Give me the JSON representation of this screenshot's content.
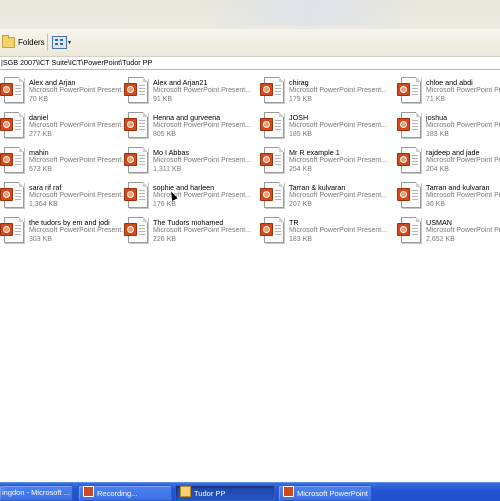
{
  "toolbar": {
    "folders_label": "Folders",
    "views_icon": "views-icon"
  },
  "address": {
    "path": "|SGB 2007\\ICT Suite\\ICT\\PowerPoint\\Tudor PP"
  },
  "files": [
    {
      "name": "Alex and Arjan",
      "type": "Microsoft PowerPoint Present...",
      "size": "70 KB"
    },
    {
      "name": "Alex and Arjan21",
      "type": "Microsoft PowerPoint Present...",
      "size": "91 KB"
    },
    {
      "name": "chirag",
      "type": "Microsoft PowerPoint Present...",
      "size": "179 KB"
    },
    {
      "name": "chloe and abdi",
      "type": "Microsoft PowerPoint Present...",
      "size": "71 KB"
    },
    {
      "name": "daniel",
      "type": "Microsoft PowerPoint Present...",
      "size": "277 KB"
    },
    {
      "name": "Henna and gurveena",
      "type": "Microsoft PowerPoint Present...",
      "size": "805 KB"
    },
    {
      "name": "JOSH",
      "type": "Microsoft PowerPoint Present...",
      "size": "185 KB"
    },
    {
      "name": "joshua",
      "type": "Microsoft PowerPoint Present...",
      "size": "183 KB"
    },
    {
      "name": "mahin",
      "type": "Microsoft PowerPoint Present...",
      "size": "673 KB"
    },
    {
      "name": "Mo I Abbas",
      "type": "Microsoft PowerPoint Present...",
      "size": "1,311 KB"
    },
    {
      "name": "Mr R example 1",
      "type": "Microsoft PowerPoint Present...",
      "size": "254 KB"
    },
    {
      "name": "rajdeep and jade",
      "type": "Microsoft PowerPoint Present...",
      "size": "204 KB"
    },
    {
      "name": "sara rif raf",
      "type": "Microsoft PowerPoint Present...",
      "size": "1,364 KB"
    },
    {
      "name": "sophie and harleen",
      "type": "Microsoft PowerPoint Present...",
      "size": "176 KB"
    },
    {
      "name": "Tarran & kulvaran",
      "type": "Microsoft PowerPoint Present...",
      "size": "207 KB"
    },
    {
      "name": "Tarran and kulvaran",
      "type": "Microsoft PowerPoint Present...",
      "size": "36 KB"
    },
    {
      "name": "the tudors by em and jodi",
      "type": "Microsoft PowerPoint Present...",
      "size": "303 KB"
    },
    {
      "name": "The Tudors mohamed",
      "type": "Microsoft PowerPoint Present...",
      "size": "226 KB"
    },
    {
      "name": "TR",
      "type": "Microsoft PowerPoint Present...",
      "size": "183 KB"
    },
    {
      "name": "USMAN",
      "type": "Microsoft PowerPoint Present...",
      "size": "2,652 KB"
    }
  ],
  "taskbar": {
    "items": [
      {
        "label": "ingdon - Microsoft ...",
        "icon": "ie-icon"
      },
      {
        "label": "Recording...",
        "icon": "recording-icon"
      },
      {
        "label": "Tudor PP",
        "icon": "folder-icon"
      },
      {
        "label": "Microsoft PowerPoint",
        "icon": "powerpoint-icon"
      }
    ]
  },
  "colors": {
    "taskbar": "#2254d3",
    "powerpoint_accent": "#d24a1c",
    "meta_text": "#7a7a7a"
  }
}
